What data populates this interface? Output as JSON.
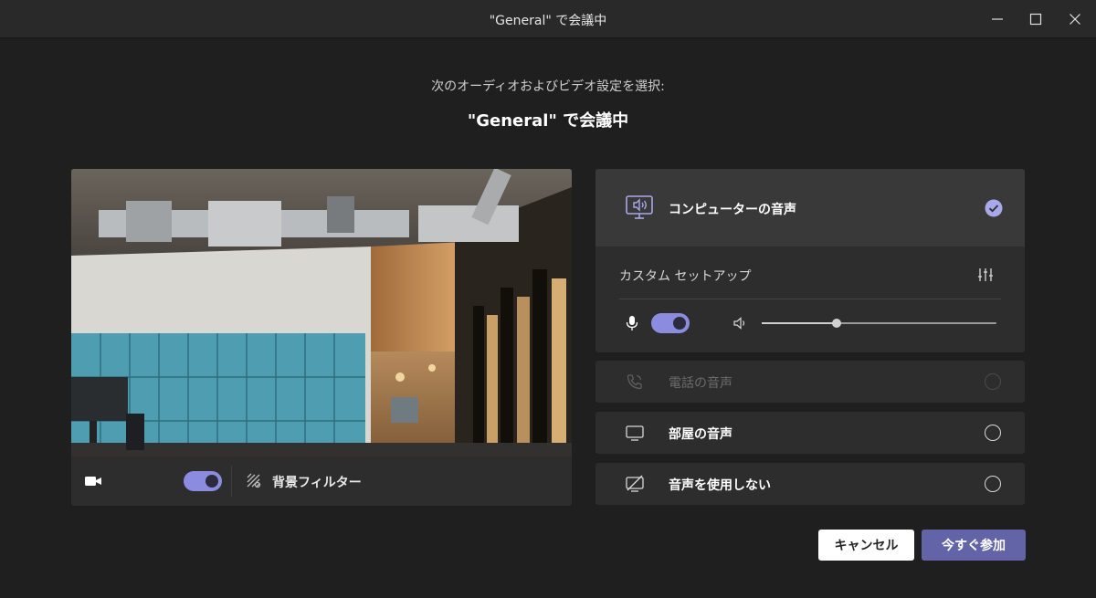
{
  "window": {
    "title": "\"General\" で会議中"
  },
  "header": {
    "subtitle": "次のオーディオおよびビデオ設定を選択:",
    "meeting_title": "\"General\" で会議中"
  },
  "video": {
    "camera_on": true,
    "background_filter_label": "背景フィルター"
  },
  "audio": {
    "computer_audio_label": "コンピューターの音声",
    "computer_audio_selected": true,
    "custom_setup_label": "カスタム セットアップ",
    "mic_on": true,
    "speaker_volume": 0.32
  },
  "options": [
    {
      "label": "電話の音声",
      "icon": "phone-audio-icon",
      "enabled": false,
      "selected": false
    },
    {
      "label": "部屋の音声",
      "icon": "room-audio-icon",
      "enabled": true,
      "selected": false
    },
    {
      "label": "音声を使用しない",
      "icon": "no-audio-icon",
      "enabled": true,
      "selected": false
    }
  ],
  "buttons": {
    "cancel_label": "キャンセル",
    "join_label": "今すぐ参加"
  },
  "colors": {
    "accent": "#6264a7",
    "toggle_on": "#8b8ce0",
    "background": "#1f1f1f",
    "card": "#2d2d2d"
  }
}
